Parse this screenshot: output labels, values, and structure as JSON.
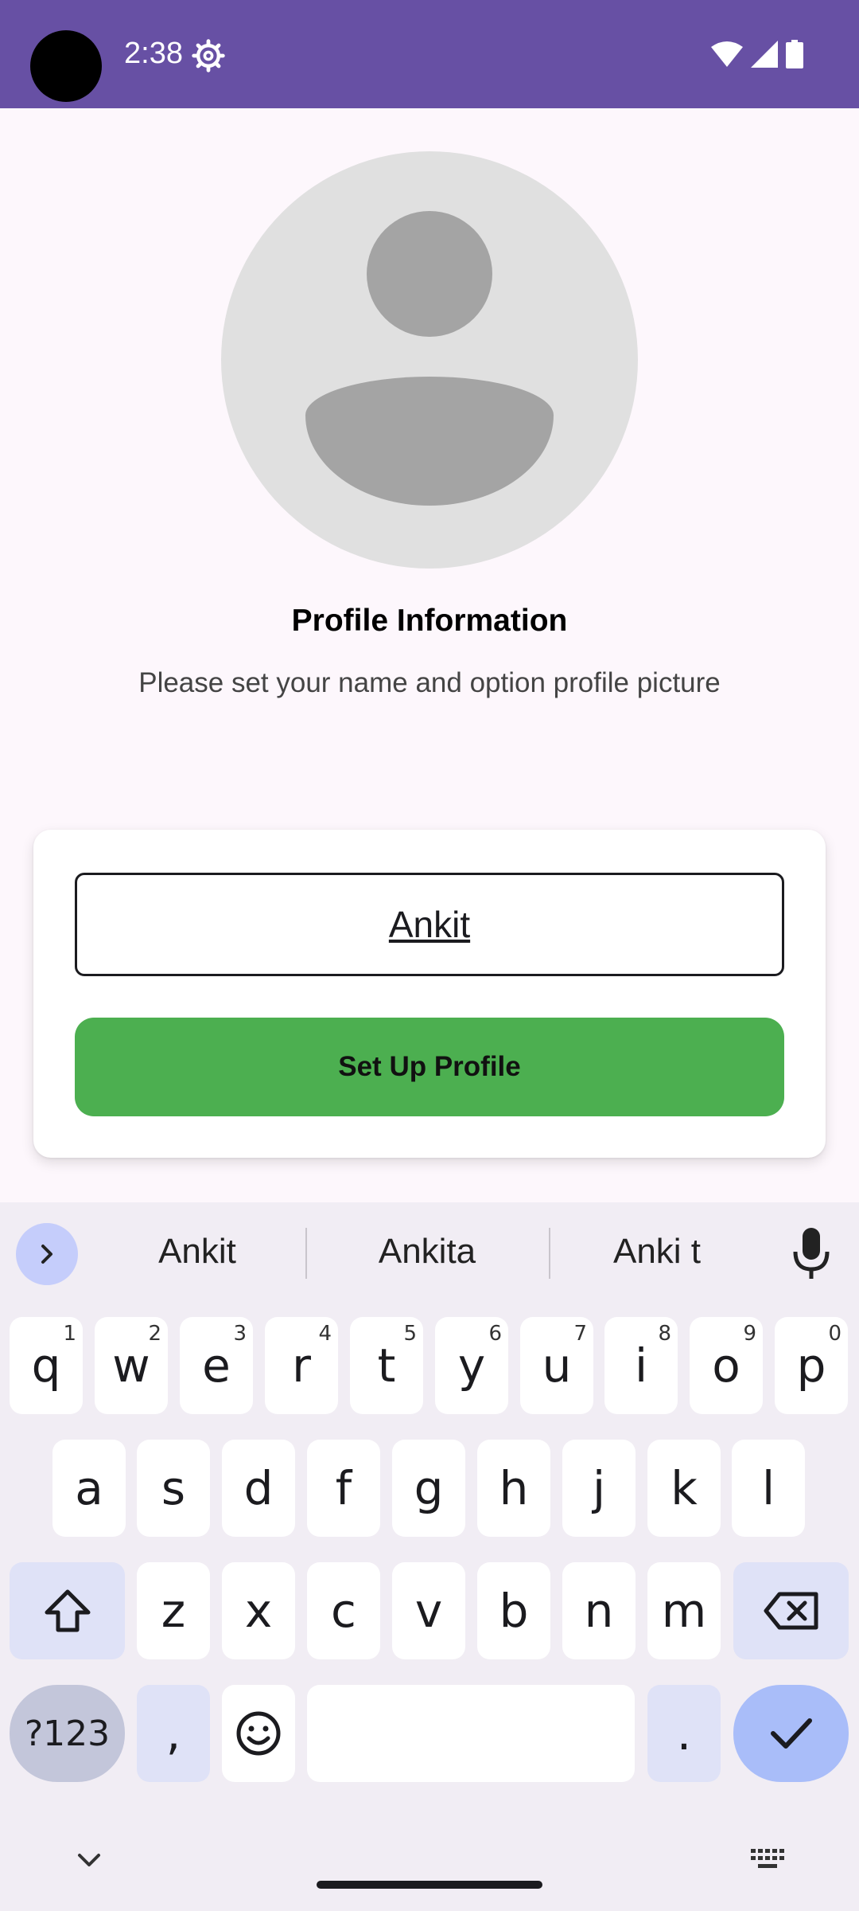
{
  "status_bar": {
    "time": "2:38",
    "background": "#6750a4",
    "icons": [
      "settings-icon",
      "wifi-icon",
      "signal-icon",
      "battery-icon"
    ]
  },
  "profile": {
    "title": "Profile Information",
    "subtitle": "Please set your name and option profile picture",
    "name_value": "Ankit",
    "setup_button_label": "Set Up Profile",
    "button_color": "#4caf50"
  },
  "keyboard": {
    "suggestions": [
      "Ankit",
      "Ankita",
      "Anki t"
    ],
    "row1": [
      {
        "k": "q",
        "n": "1"
      },
      {
        "k": "w",
        "n": "2"
      },
      {
        "k": "e",
        "n": "3"
      },
      {
        "k": "r",
        "n": "4"
      },
      {
        "k": "t",
        "n": "5"
      },
      {
        "k": "y",
        "n": "6"
      },
      {
        "k": "u",
        "n": "7"
      },
      {
        "k": "i",
        "n": "8"
      },
      {
        "k": "o",
        "n": "9"
      },
      {
        "k": "p",
        "n": "0"
      }
    ],
    "row2": [
      "a",
      "s",
      "d",
      "f",
      "g",
      "h",
      "j",
      "k",
      "l"
    ],
    "row3": [
      "z",
      "x",
      "c",
      "v",
      "b",
      "n",
      "m"
    ],
    "symbols_label": "?123",
    "comma_label": ",",
    "period_label": "."
  }
}
